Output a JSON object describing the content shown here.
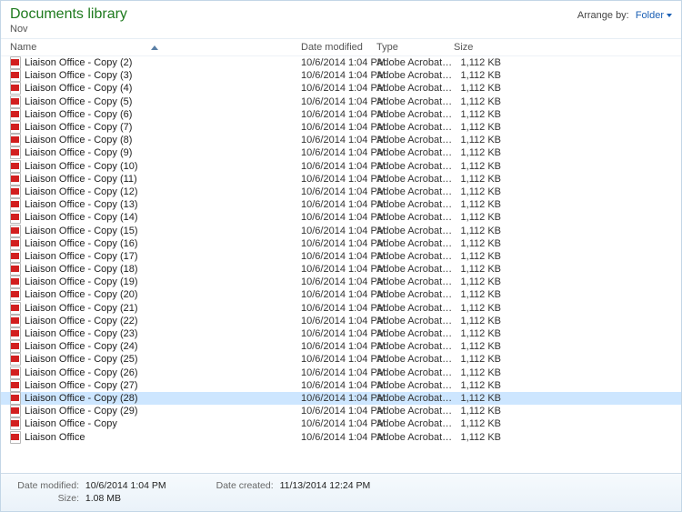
{
  "header": {
    "title": "Documents library",
    "subtitle": "Nov",
    "arrange_label": "Arrange by:",
    "arrange_value": "Folder"
  },
  "columns": {
    "name": "Name",
    "date": "Date modified",
    "type": "Type",
    "size": "Size"
  },
  "file_defaults": {
    "date": "10/6/2014 1:04 PM",
    "type": "Adobe Acrobat D...",
    "size": "1,112 KB"
  },
  "files": [
    {
      "name": "Liaison Office - Copy (2)"
    },
    {
      "name": "Liaison Office - Copy (3)"
    },
    {
      "name": "Liaison Office - Copy (4)"
    },
    {
      "name": "Liaison Office - Copy (5)"
    },
    {
      "name": "Liaison Office - Copy (6)"
    },
    {
      "name": "Liaison Office - Copy (7)"
    },
    {
      "name": "Liaison Office - Copy (8)"
    },
    {
      "name": "Liaison Office - Copy (9)"
    },
    {
      "name": "Liaison Office - Copy (10)"
    },
    {
      "name": "Liaison Office - Copy (11)"
    },
    {
      "name": "Liaison Office - Copy (12)"
    },
    {
      "name": "Liaison Office - Copy (13)"
    },
    {
      "name": "Liaison Office - Copy (14)"
    },
    {
      "name": "Liaison Office - Copy (15)"
    },
    {
      "name": "Liaison Office - Copy (16)"
    },
    {
      "name": "Liaison Office - Copy (17)"
    },
    {
      "name": "Liaison Office - Copy (18)"
    },
    {
      "name": "Liaison Office - Copy (19)"
    },
    {
      "name": "Liaison Office - Copy (20)"
    },
    {
      "name": "Liaison Office - Copy (21)"
    },
    {
      "name": "Liaison Office - Copy (22)"
    },
    {
      "name": "Liaison Office - Copy (23)"
    },
    {
      "name": "Liaison Office - Copy (24)"
    },
    {
      "name": "Liaison Office - Copy (25)"
    },
    {
      "name": "Liaison Office - Copy (26)"
    },
    {
      "name": "Liaison Office - Copy (27)"
    },
    {
      "name": "Liaison Office - Copy (28)",
      "selected": true
    },
    {
      "name": "Liaison Office - Copy (29)"
    },
    {
      "name": "Liaison Office - Copy"
    },
    {
      "name": "Liaison Office"
    }
  ],
  "details": {
    "date_modified_label": "Date modified:",
    "date_modified_value": "10/6/2014 1:04 PM",
    "size_label": "Size:",
    "size_value": "1.08 MB",
    "date_created_label": "Date created:",
    "date_created_value": "11/13/2014 12:24 PM"
  }
}
